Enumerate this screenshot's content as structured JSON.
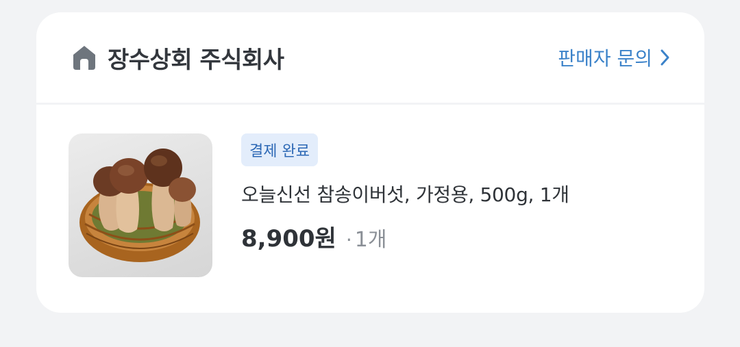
{
  "store": {
    "name": "장수상회 주식회사",
    "icon": "store-icon"
  },
  "seller_inquiry": {
    "label": "판매자 문의",
    "icon": "chevron-right-icon"
  },
  "order": {
    "status": "결제 완료",
    "product_name": "오늘신선 참송이버섯, 가정용, 500g, 1개",
    "price": "8,900원",
    "separator": "·",
    "quantity": "1개",
    "image": "mushroom-product-image"
  },
  "colors": {
    "accent": "#3b82c9",
    "badge_bg": "#e3edfb",
    "badge_text": "#2c68b5",
    "text_primary": "#2f3338",
    "text_secondary": "#8a8f96",
    "page_bg": "#f2f3f5"
  }
}
